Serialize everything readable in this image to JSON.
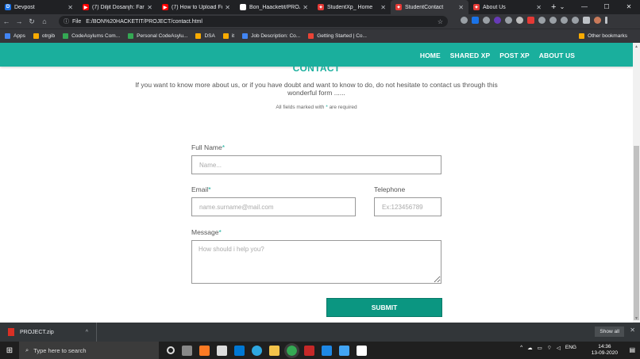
{
  "browser": {
    "tabs": [
      {
        "label": "Devpost",
        "color": "#1a73e8",
        "glyph": "D",
        "active": false
      },
      {
        "label": "(7) Diljit Dosanjh: Faruz",
        "color": "#ff0000",
        "glyph": "▶",
        "active": false
      },
      {
        "label": "(7) How to Upload Fol",
        "color": "#ff0000",
        "glyph": "▶",
        "active": false
      },
      {
        "label": "Bon_Haacketit/PROJEC",
        "color": "#ffffff",
        "glyph": "",
        "active": false
      },
      {
        "label": "StudentXp_ Home",
        "color": "#e53935",
        "glyph": "✦",
        "active": false
      },
      {
        "label": "StudentContact",
        "color": "#e53935",
        "glyph": "✦",
        "active": true
      },
      {
        "label": "About Us",
        "color": "#e53935",
        "glyph": "✦",
        "active": false
      }
    ],
    "new_tab": "+",
    "address": {
      "scheme": "File",
      "url": "E:/BON%20HACKETIT/PROJECT/contact.html"
    },
    "bookmarks": [
      {
        "label": "Apps",
        "color": "#4285f4"
      },
      {
        "label": "otrgib",
        "color": "#f9ab00"
      },
      {
        "label": "CodeAsylums Com...",
        "color": "#34a853"
      },
      {
        "label": "Personal CodeAsylu...",
        "color": "#34a853"
      },
      {
        "label": "DSA",
        "color": "#f9ab00"
      },
      {
        "label": "it",
        "color": "#f9ab00"
      },
      {
        "label": "Job Description: Co...",
        "color": "#4285f4"
      },
      {
        "label": "Getting Started | Co...",
        "color": "#ea4335"
      }
    ],
    "other_bookmarks": "Other bookmarks"
  },
  "site": {
    "nav": [
      {
        "label": "HOME"
      },
      {
        "label": "SHARED XP"
      },
      {
        "label": "POST XP"
      },
      {
        "label": "ABOUT US"
      }
    ],
    "title": "CONTACT",
    "intro": "If you want to know more about us, or if you have doubt and want to know to do, do not hesitate to contact us through this wonderful form ......",
    "required_note_before": "All fields marked with ",
    "required_note_mark": "*",
    "required_note_after": " are required"
  },
  "form": {
    "full_name": {
      "label": "Full Name",
      "mark": "*",
      "placeholder": "Name..."
    },
    "email": {
      "label": "Email",
      "mark": "*",
      "placeholder": "name.surname@mail.com"
    },
    "telephone": {
      "label": "Telephone",
      "placeholder": "Ex:123456789"
    },
    "message": {
      "label": "Message",
      "mark": "*",
      "placeholder": "How should i help you?"
    },
    "submit": "SUBMIT"
  },
  "downloads": {
    "file": "PROJECT.zip",
    "show_all": "Show all"
  },
  "taskbar": {
    "search_placeholder": "Type here to search",
    "lang": "ENG",
    "time": "14:36",
    "date": "13-09-2020"
  }
}
